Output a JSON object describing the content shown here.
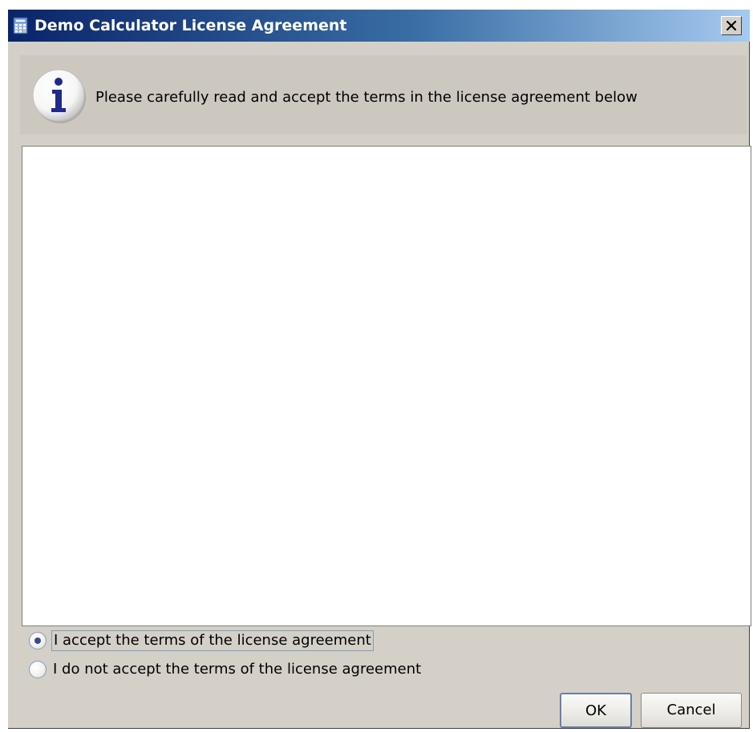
{
  "window": {
    "title": "Demo Calculator License Agreement",
    "close_glyph": "✕"
  },
  "info": {
    "icon": "info-icon",
    "message": "Please carefully read and accept the terms in the license agreement below"
  },
  "license": {
    "text": ""
  },
  "options": {
    "accept_label": "I accept the terms of the license agreement",
    "decline_label": "I do not accept the terms of the license agreement",
    "selected": "accept"
  },
  "buttons": {
    "ok_label": "OK",
    "cancel_label": "Cancel"
  },
  "colors": {
    "titlebar_start": "#0a246a",
    "titlebar_end": "#a6caf0",
    "dialog_bg": "#d4d0c8",
    "info_icon_color": "#1f2a8c"
  }
}
